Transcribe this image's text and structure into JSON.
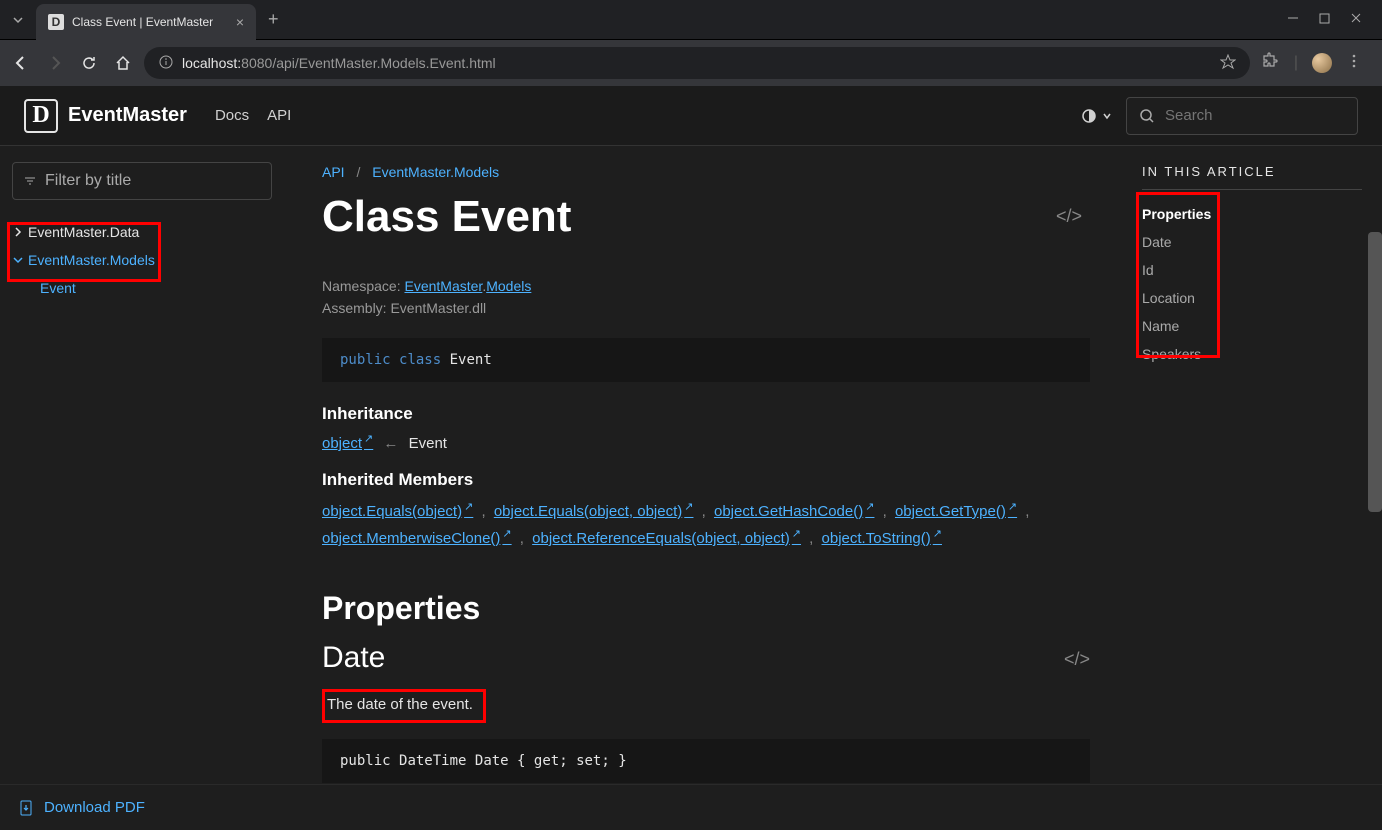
{
  "browser": {
    "tab_title": "Class Event | EventMaster",
    "url_host": "localhost:",
    "url_port": "8080",
    "url_path": "/api/EventMaster.Models.Event.html"
  },
  "header": {
    "brand": "EventMaster",
    "nav": {
      "docs": "Docs",
      "api": "API"
    },
    "search_placeholder": "Search"
  },
  "sidebar": {
    "filter_placeholder": "Filter by title",
    "items": [
      {
        "label": "EventMaster.Data"
      },
      {
        "label": "EventMaster.Models"
      },
      {
        "label": "Event"
      }
    ]
  },
  "main": {
    "breadcrumb": {
      "root": "API",
      "section": "EventMaster.Models"
    },
    "title": "Class Event",
    "namespace_label": "Namespace:",
    "namespace_ns": "EventMaster",
    "namespace_sub": "Models",
    "assembly_label": "Assembly: EventMaster.dll",
    "decl_kw1": "public",
    "decl_kw2": "class",
    "decl_name": "Event",
    "inheritance_h": "Inheritance",
    "inherit_base": "object",
    "inherit_self": "Event",
    "members_h": "Inherited Members",
    "members": [
      "object.Equals(object)",
      "object.Equals(object, object)",
      "object.GetHashCode()",
      "object.GetType()",
      "object.MemberwiseClone()",
      "object.ReferenceEquals(object, object)",
      "object.ToString()"
    ],
    "props_h": "Properties",
    "prop1_name": "Date",
    "prop1_desc": "The date of the event.",
    "prop1_kw": "public",
    "prop1_type": "DateTime",
    "prop1_ident": "Date",
    "prop1_get": "get",
    "prop1_set": "set"
  },
  "toc": {
    "title": "IN THIS ARTICLE",
    "items": [
      "Properties",
      "Date",
      "Id",
      "Location",
      "Name",
      "Speakers"
    ]
  },
  "footer": {
    "download": "Download PDF"
  }
}
